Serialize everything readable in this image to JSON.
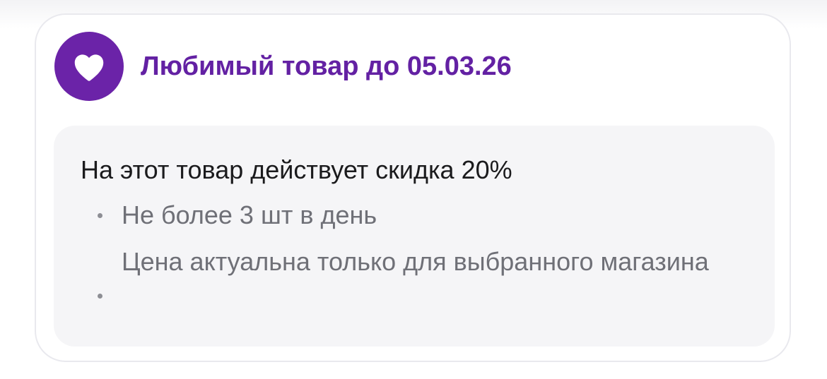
{
  "offer": {
    "icon": "heart-icon",
    "title": "Любимый товар до 05.03.26",
    "headline": "На этот товар действует скидка 20%",
    "conditions": [
      "Не более 3 шт в день",
      "Цена актуальна только для выбранного магазина"
    ]
  },
  "colors": {
    "accent": "#6b23a8",
    "title": "#6321a3",
    "panel_background": "#f5f5f7",
    "headline_text": "#1b1b1d",
    "bullet_text": "#6f7077"
  }
}
